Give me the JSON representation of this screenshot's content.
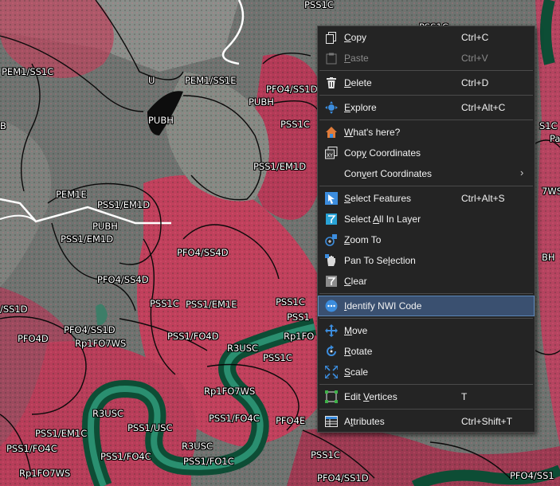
{
  "map": {
    "labels": [
      "PEM1/SS1C",
      "U",
      "PEM1/SS1E",
      "PFO4/SS1D",
      "PUBH",
      "B",
      "PUBH",
      "PSS1C",
      "PSS1/EM1D",
      "PEM1E",
      "PSS1/EM1D",
      "PUBH",
      "PSS1/EM1D",
      "PFO4/SS4D",
      "PFO4/SS4D",
      "/SS1D",
      "PSS1C",
      "PSS1/EM1E",
      "PSS1C",
      "PSS1",
      "PFO4/SS1D",
      "PFO4D",
      "PSS1/FO4D",
      "Rp1FO",
      "R3USC",
      "PSS1C",
      "Rp1FO7WS",
      "Rp1FO7WS",
      "R3USC",
      "PSS1/FO4C",
      "PFO4E",
      "PSS1/EM1C",
      "PSS1/USC",
      "PSS1/FO4C",
      "R3USC",
      "PSS1/FO4C",
      "PSS1/FO1C",
      "PSS1C",
      "Rp1FO7WS",
      "PFO4/SS1D",
      "PFO4/SS1",
      "PSS1C",
      "PSS1C",
      "S1C",
      "Pa",
      "7WS",
      "BH"
    ]
  },
  "context_menu": {
    "items": [
      {
        "label": "Copy",
        "underline": "C",
        "rest": "opy",
        "prefix": "",
        "shortcut": "Ctrl+C",
        "icon": "copy-icon",
        "disabled": false
      },
      {
        "label": "Paste",
        "underline": "P",
        "rest": "aste",
        "prefix": "",
        "shortcut": "Ctrl+V",
        "icon": "paste-icon",
        "disabled": true
      },
      {
        "label": "Delete",
        "underline": "D",
        "rest": "elete",
        "prefix": "",
        "shortcut": "Ctrl+D",
        "icon": "delete-icon",
        "disabled": false
      },
      {
        "label": "Explore",
        "underline": "E",
        "rest": "xplore",
        "prefix": "",
        "shortcut": "Ctrl+Alt+C",
        "icon": "explore-icon",
        "disabled": false
      },
      {
        "label": "What's here?",
        "underline": "W",
        "rest": "hat's here?",
        "prefix": "",
        "shortcut": "",
        "icon": "whats-here-icon",
        "disabled": false
      },
      {
        "label": "Copy Coordinates",
        "underline": "y",
        "rest": " Coordinates",
        "prefix": "Cop",
        "shortcut": "",
        "icon": "copy-coordinates-icon",
        "disabled": false
      },
      {
        "label": "Convert Coordinates",
        "underline": "v",
        "rest": "ert Coordinates",
        "prefix": "Con",
        "shortcut": "",
        "icon": "",
        "disabled": false
      },
      {
        "label": "Select Features",
        "underline": "S",
        "rest": "elect Features",
        "prefix": "",
        "shortcut": "Ctrl+Alt+S",
        "icon": "select-features-icon",
        "disabled": false
      },
      {
        "label": "Select All In Layer",
        "underline": "A",
        "rest": "ll In Layer",
        "prefix": "Select ",
        "shortcut": "",
        "icon": "select-all-icon",
        "disabled": false
      },
      {
        "label": "Zoom To",
        "underline": "Z",
        "rest": "oom To",
        "prefix": "",
        "shortcut": "",
        "icon": "zoom-to-icon",
        "disabled": false
      },
      {
        "label": "Pan To Selection",
        "underline": "l",
        "rest": "ection",
        "prefix": "Pan To Se",
        "shortcut": "",
        "icon": "pan-to-icon",
        "disabled": false
      },
      {
        "label": "Clear",
        "underline": "C",
        "rest": "lear",
        "prefix": "",
        "shortcut": "",
        "icon": "clear-icon",
        "disabled": false
      },
      {
        "label": "Identify NWI Code",
        "underline": "I",
        "rest": "dentify NWI Code",
        "prefix": "",
        "shortcut": "",
        "icon": "identify-icon",
        "disabled": false
      },
      {
        "label": "Move",
        "underline": "M",
        "rest": "ove",
        "prefix": "",
        "shortcut": "",
        "icon": "move-icon",
        "disabled": false
      },
      {
        "label": "Rotate",
        "underline": "R",
        "rest": "otate",
        "prefix": "",
        "shortcut": "",
        "icon": "rotate-icon",
        "disabled": false
      },
      {
        "label": "Scale",
        "underline": "S",
        "rest": "cale",
        "prefix": "",
        "shortcut": "",
        "icon": "scale-icon",
        "disabled": false
      },
      {
        "label": "Edit Vertices",
        "underline": "V",
        "rest": "ertices",
        "prefix": "Edit ",
        "shortcut": "T",
        "icon": "edit-vertices-icon",
        "disabled": false
      },
      {
        "label": "Attributes",
        "underline": "t",
        "rest": "tributes",
        "prefix": "A",
        "shortcut": "Ctrl+Shift+T",
        "icon": "attributes-icon",
        "disabled": false
      }
    ],
    "highlighted": "Identify NWI Code"
  }
}
